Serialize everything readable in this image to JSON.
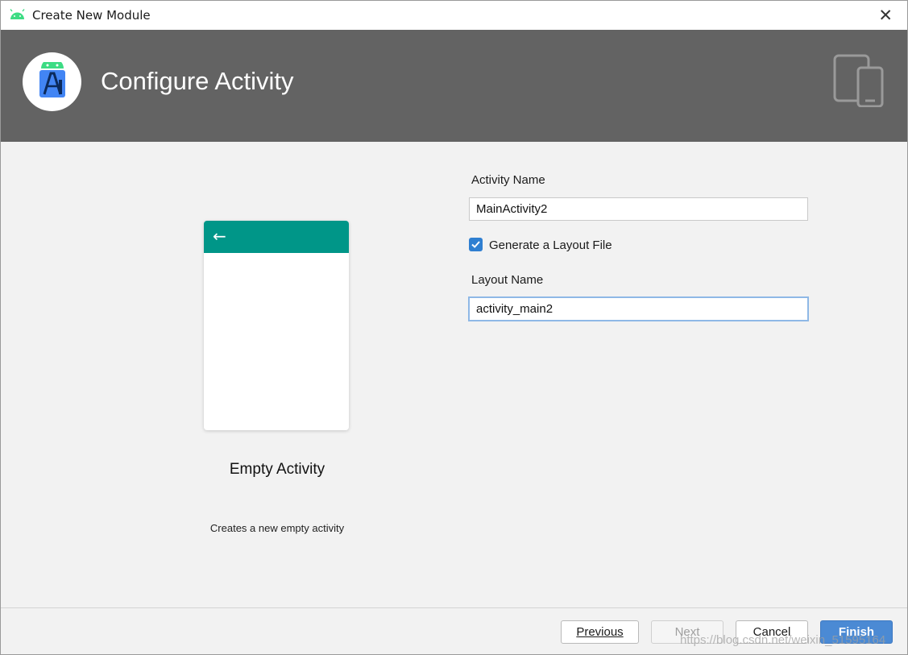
{
  "window": {
    "title": "Create New Module",
    "close_glyph": "✕"
  },
  "header": {
    "heading": "Configure Activity"
  },
  "preview": {
    "back_glyph": "←",
    "template_name": "Empty Activity",
    "template_description": "Creates a new empty activity",
    "appbar_color": "#009688"
  },
  "form": {
    "activity_name_label": "Activity Name",
    "activity_name_value": "MainActivity2",
    "generate_layout_label": "Generate a Layout File",
    "generate_layout_checked": true,
    "layout_name_label": "Layout Name",
    "layout_name_value": "activity_main2"
  },
  "footer": {
    "previous_label": "Previous",
    "next_label": "Next",
    "cancel_label": "Cancel",
    "finish_label": "Finish",
    "watermark": "https://blog.csdn.net/weixin_51595164"
  },
  "colors": {
    "header_bg": "#636363",
    "accent": "#2f7fd1",
    "primary_button": "#4b8ad4"
  },
  "icons": [
    "android-icon",
    "close-icon",
    "android-studio-logo-icon",
    "devices-icon",
    "back-arrow-icon",
    "checkmark-icon"
  ]
}
